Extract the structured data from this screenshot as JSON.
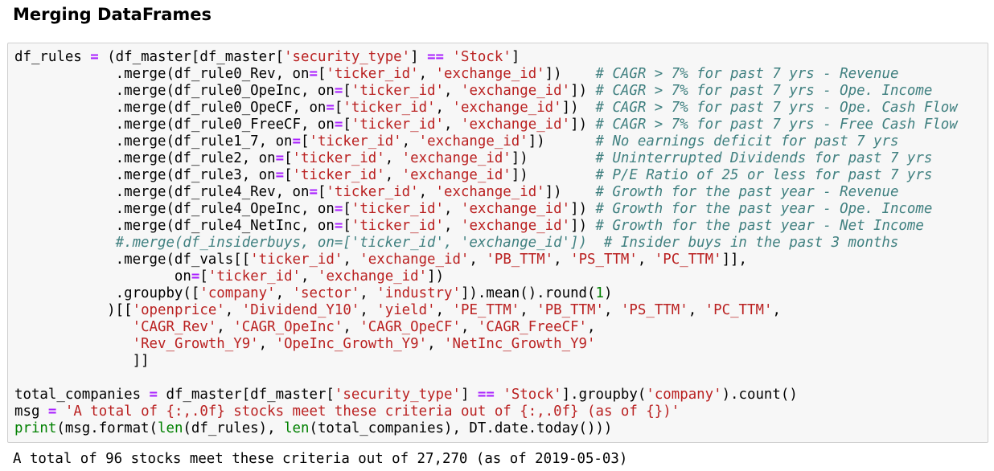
{
  "heading": "Merging DataFrames",
  "code_lines": [
    [
      {
        "t": "df_rules "
      },
      {
        "t": "=",
        "c": "o"
      },
      {
        "t": " (df_master[df_master["
      },
      {
        "t": "'security_type'",
        "c": "s"
      },
      {
        "t": "] "
      },
      {
        "t": "==",
        "c": "o"
      },
      {
        "t": " "
      },
      {
        "t": "'Stock'",
        "c": "s"
      },
      {
        "t": "]"
      }
    ],
    [
      {
        "t": "            .merge(df_rule0_Rev, on"
      },
      {
        "t": "=",
        "c": "o"
      },
      {
        "t": "["
      },
      {
        "t": "'ticker_id'",
        "c": "s"
      },
      {
        "t": ", "
      },
      {
        "t": "'exchange_id'",
        "c": "s"
      },
      {
        "t": "])    "
      },
      {
        "t": "# CAGR > 7% for past 7 yrs - Revenue",
        "c": "c"
      }
    ],
    [
      {
        "t": "            .merge(df_rule0_OpeInc, on"
      },
      {
        "t": "=",
        "c": "o"
      },
      {
        "t": "["
      },
      {
        "t": "'ticker_id'",
        "c": "s"
      },
      {
        "t": ", "
      },
      {
        "t": "'exchange_id'",
        "c": "s"
      },
      {
        "t": "]) "
      },
      {
        "t": "# CAGR > 7% for past 7 yrs - Ope. Income",
        "c": "c"
      }
    ],
    [
      {
        "t": "            .merge(df_rule0_OpeCF, on"
      },
      {
        "t": "=",
        "c": "o"
      },
      {
        "t": "["
      },
      {
        "t": "'ticker_id'",
        "c": "s"
      },
      {
        "t": ", "
      },
      {
        "t": "'exchange_id'",
        "c": "s"
      },
      {
        "t": "])  "
      },
      {
        "t": "# CAGR > 7% for past 7 yrs - Ope. Cash Flow",
        "c": "c"
      }
    ],
    [
      {
        "t": "            .merge(df_rule0_FreeCF, on"
      },
      {
        "t": "=",
        "c": "o"
      },
      {
        "t": "["
      },
      {
        "t": "'ticker_id'",
        "c": "s"
      },
      {
        "t": ", "
      },
      {
        "t": "'exchange_id'",
        "c": "s"
      },
      {
        "t": "]) "
      },
      {
        "t": "# CAGR > 7% for past 7 yrs - Free Cash Flow",
        "c": "c"
      }
    ],
    [
      {
        "t": "            .merge(df_rule1_7, on"
      },
      {
        "t": "=",
        "c": "o"
      },
      {
        "t": "["
      },
      {
        "t": "'ticker_id'",
        "c": "s"
      },
      {
        "t": ", "
      },
      {
        "t": "'exchange_id'",
        "c": "s"
      },
      {
        "t": "])      "
      },
      {
        "t": "# No earnings deficit for past 7 yrs",
        "c": "c"
      }
    ],
    [
      {
        "t": "            .merge(df_rule2, on"
      },
      {
        "t": "=",
        "c": "o"
      },
      {
        "t": "["
      },
      {
        "t": "'ticker_id'",
        "c": "s"
      },
      {
        "t": ", "
      },
      {
        "t": "'exchange_id'",
        "c": "s"
      },
      {
        "t": "])        "
      },
      {
        "t": "# Uninterrupted Dividends for past 7 yrs",
        "c": "c"
      }
    ],
    [
      {
        "t": "            .merge(df_rule3, on"
      },
      {
        "t": "=",
        "c": "o"
      },
      {
        "t": "["
      },
      {
        "t": "'ticker_id'",
        "c": "s"
      },
      {
        "t": ", "
      },
      {
        "t": "'exchange_id'",
        "c": "s"
      },
      {
        "t": "])        "
      },
      {
        "t": "# P/E Ratio of 25 or less for past 7 yrs",
        "c": "c"
      }
    ],
    [
      {
        "t": "            .merge(df_rule4_Rev, on"
      },
      {
        "t": "=",
        "c": "o"
      },
      {
        "t": "["
      },
      {
        "t": "'ticker_id'",
        "c": "s"
      },
      {
        "t": ", "
      },
      {
        "t": "'exchange_id'",
        "c": "s"
      },
      {
        "t": "])    "
      },
      {
        "t": "# Growth for the past year - Revenue",
        "c": "c"
      }
    ],
    [
      {
        "t": "            .merge(df_rule4_OpeInc, on"
      },
      {
        "t": "=",
        "c": "o"
      },
      {
        "t": "["
      },
      {
        "t": "'ticker_id'",
        "c": "s"
      },
      {
        "t": ", "
      },
      {
        "t": "'exchange_id'",
        "c": "s"
      },
      {
        "t": "]) "
      },
      {
        "t": "# Growth for the past year - Ope. Income",
        "c": "c"
      }
    ],
    [
      {
        "t": "            .merge(df_rule4_NetInc, on"
      },
      {
        "t": "=",
        "c": "o"
      },
      {
        "t": "["
      },
      {
        "t": "'ticker_id'",
        "c": "s"
      },
      {
        "t": ", "
      },
      {
        "t": "'exchange_id'",
        "c": "s"
      },
      {
        "t": "]) "
      },
      {
        "t": "# Growth for the past year - Net Income",
        "c": "c"
      }
    ],
    [
      {
        "t": "            "
      },
      {
        "t": "#.merge(df_insiderbuys, on=['ticker_id', 'exchange_id'])  # Insider buys in the past 3 months",
        "c": "c"
      }
    ],
    [
      {
        "t": "            .merge(df_vals[["
      },
      {
        "t": "'ticker_id'",
        "c": "s"
      },
      {
        "t": ", "
      },
      {
        "t": "'exchange_id'",
        "c": "s"
      },
      {
        "t": ", "
      },
      {
        "t": "'PB_TTM'",
        "c": "s"
      },
      {
        "t": ", "
      },
      {
        "t": "'PS_TTM'",
        "c": "s"
      },
      {
        "t": ", "
      },
      {
        "t": "'PC_TTM'",
        "c": "s"
      },
      {
        "t": "]],"
      }
    ],
    [
      {
        "t": "                   on"
      },
      {
        "t": "=",
        "c": "o"
      },
      {
        "t": "["
      },
      {
        "t": "'ticker_id'",
        "c": "s"
      },
      {
        "t": ", "
      },
      {
        "t": "'exchange_id'",
        "c": "s"
      },
      {
        "t": "])"
      }
    ],
    [
      {
        "t": "            .groupby(["
      },
      {
        "t": "'company'",
        "c": "s"
      },
      {
        "t": ", "
      },
      {
        "t": "'sector'",
        "c": "s"
      },
      {
        "t": ", "
      },
      {
        "t": "'industry'",
        "c": "s"
      },
      {
        "t": "]).mean().round("
      },
      {
        "t": "1",
        "c": "n"
      },
      {
        "t": ")"
      }
    ],
    [
      {
        "t": "           )[["
      },
      {
        "t": "'openprice'",
        "c": "s"
      },
      {
        "t": ", "
      },
      {
        "t": "'Dividend_Y10'",
        "c": "s"
      },
      {
        "t": ", "
      },
      {
        "t": "'yield'",
        "c": "s"
      },
      {
        "t": ", "
      },
      {
        "t": "'PE_TTM'",
        "c": "s"
      },
      {
        "t": ", "
      },
      {
        "t": "'PB_TTM'",
        "c": "s"
      },
      {
        "t": ", "
      },
      {
        "t": "'PS_TTM'",
        "c": "s"
      },
      {
        "t": ", "
      },
      {
        "t": "'PC_TTM'",
        "c": "s"
      },
      {
        "t": ","
      }
    ],
    [
      {
        "t": "              "
      },
      {
        "t": "'CAGR_Rev'",
        "c": "s"
      },
      {
        "t": ", "
      },
      {
        "t": "'CAGR_OpeInc'",
        "c": "s"
      },
      {
        "t": ", "
      },
      {
        "t": "'CAGR_OpeCF'",
        "c": "s"
      },
      {
        "t": ", "
      },
      {
        "t": "'CAGR_FreeCF'",
        "c": "s"
      },
      {
        "t": ","
      }
    ],
    [
      {
        "t": "              "
      },
      {
        "t": "'Rev_Growth_Y9'",
        "c": "s"
      },
      {
        "t": ", "
      },
      {
        "t": "'OpeInc_Growth_Y9'",
        "c": "s"
      },
      {
        "t": ", "
      },
      {
        "t": "'NetInc_Growth_Y9'",
        "c": "s"
      }
    ],
    [
      {
        "t": "              ]]"
      }
    ],
    [
      {
        "t": ""
      }
    ],
    [
      {
        "t": "total_companies "
      },
      {
        "t": "=",
        "c": "o"
      },
      {
        "t": " df_master[df_master["
      },
      {
        "t": "'security_type'",
        "c": "s"
      },
      {
        "t": "] "
      },
      {
        "t": "==",
        "c": "o"
      },
      {
        "t": " "
      },
      {
        "t": "'Stock'",
        "c": "s"
      },
      {
        "t": "].groupby("
      },
      {
        "t": "'company'",
        "c": "s"
      },
      {
        "t": ").count()"
      }
    ],
    [
      {
        "t": "msg "
      },
      {
        "t": "=",
        "c": "o"
      },
      {
        "t": " "
      },
      {
        "t": "'A total of {:,.0f} stocks meet these criteria out of {:,.0f} (as of {})'",
        "c": "s"
      }
    ],
    [
      {
        "t": "print",
        "c": "b"
      },
      {
        "t": "(msg.format("
      },
      {
        "t": "len",
        "c": "b"
      },
      {
        "t": "(df_rules), "
      },
      {
        "t": "len",
        "c": "b"
      },
      {
        "t": "(total_companies), DT.date.today()))"
      }
    ]
  ],
  "output": "A total of 96 stocks meet these criteria out of 27,270 (as of 2019-05-03)"
}
